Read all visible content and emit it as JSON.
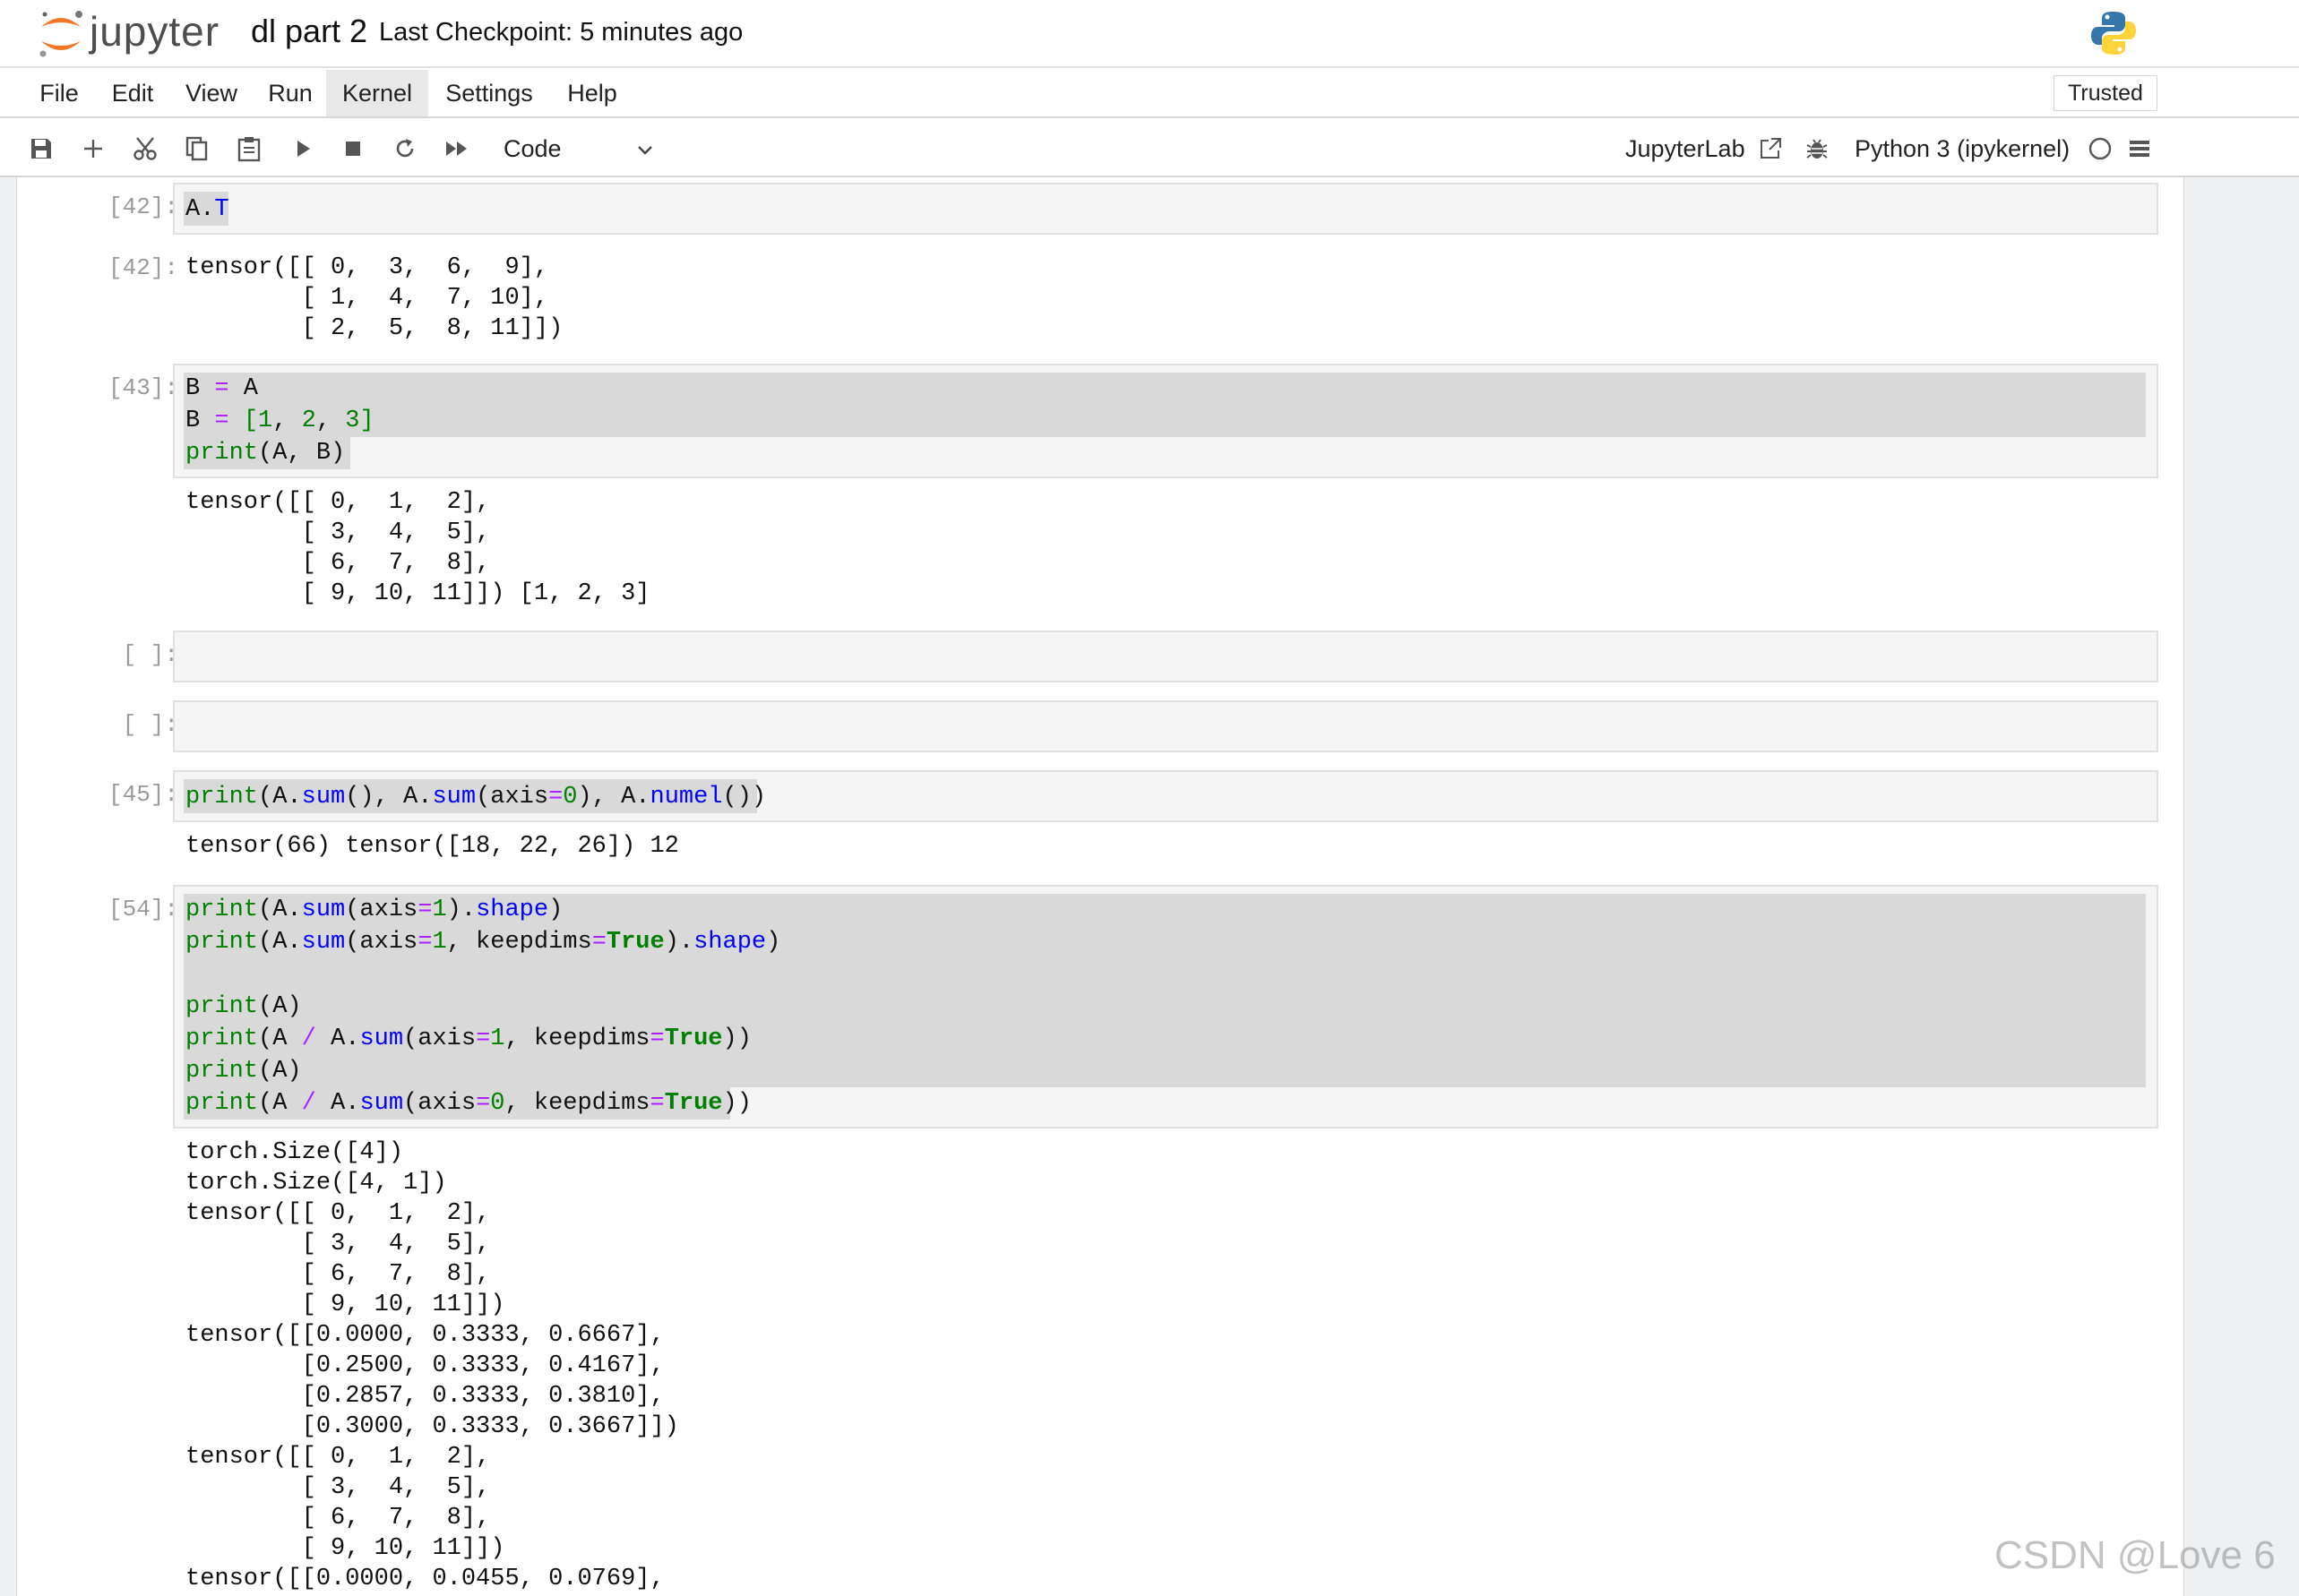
{
  "header": {
    "logo_text": "jupyter",
    "notebook_title": "dl part 2",
    "checkpoint": "Last Checkpoint: 5 minutes ago"
  },
  "menu": {
    "items": [
      "File",
      "Edit",
      "View",
      "Run",
      "Kernel",
      "Settings",
      "Help"
    ],
    "active": "Kernel",
    "trusted_label": "Trusted"
  },
  "toolbar": {
    "cell_type": "Code",
    "jupyterlab_label": "JupyterLab",
    "kernel_name": "Python 3 (ipykernel)",
    "icons": [
      "save-icon",
      "add-cell-icon",
      "cut-icon",
      "copy-icon",
      "paste-icon",
      "run-icon",
      "stop-icon",
      "restart-icon",
      "fast-forward-icon",
      "external-link-icon",
      "bug-icon",
      "kernel-status-icon",
      "menu-icon"
    ]
  },
  "cells": {
    "c1": {
      "in_prompt": "[42]:",
      "code": "A.T",
      "out_prompt": "[42]:",
      "output": "tensor([[ 0,  3,  6,  9],\n        [ 1,  4,  7, 10],\n        [ 2,  5,  8, 11]])"
    },
    "c2": {
      "in_prompt": "[43]:",
      "line1": "B = A",
      "line2": "B = [1, 2, 3]",
      "line3": "print(A, B)",
      "output": "tensor([[ 0,  1,  2],\n        [ 3,  4,  5],\n        [ 6,  7,  8],\n        [ 9, 10, 11]]) [1, 2, 3]"
    },
    "c3": {
      "in_prompt": "[ ]:"
    },
    "c4": {
      "in_prompt": "[ ]:"
    },
    "c5": {
      "in_prompt": "[45]:",
      "code": "print(A.sum(), A.sum(axis=0), A.numel())",
      "output": "tensor(66) tensor([18, 22, 26]) 12"
    },
    "c6": {
      "in_prompt": "[54]:",
      "l1": "print(A.sum(axis=1).shape)",
      "l2": "print(A.sum(axis=1, keepdims=True).shape)",
      "l3": "print(A)",
      "l4": "print(A / A.sum(axis=1, keepdims=True))",
      "l5": "print(A)",
      "l6": "print(A / A.sum(axis=0, keepdims=True))",
      "output": "torch.Size([4])\ntorch.Size([4, 1])\ntensor([[ 0,  1,  2],\n        [ 3,  4,  5],\n        [ 6,  7,  8],\n        [ 9, 10, 11]])\ntensor([[0.0000, 0.3333, 0.6667],\n        [0.2500, 0.3333, 0.4167],\n        [0.2857, 0.3333, 0.3810],\n        [0.3000, 0.3333, 0.3667]])\ntensor([[ 0,  1,  2],\n        [ 3,  4,  5],\n        [ 6,  7,  8],\n        [ 9, 10, 11]])\ntensor([[0.0000, 0.0455, 0.0769],"
    }
  },
  "watermark": "CSDN @Love 6",
  "colors": {
    "jupyter_orange": "#f37726",
    "keyword_green": "#008000",
    "attr_blue": "#0000ff",
    "operator_purple": "#aa22ff"
  }
}
